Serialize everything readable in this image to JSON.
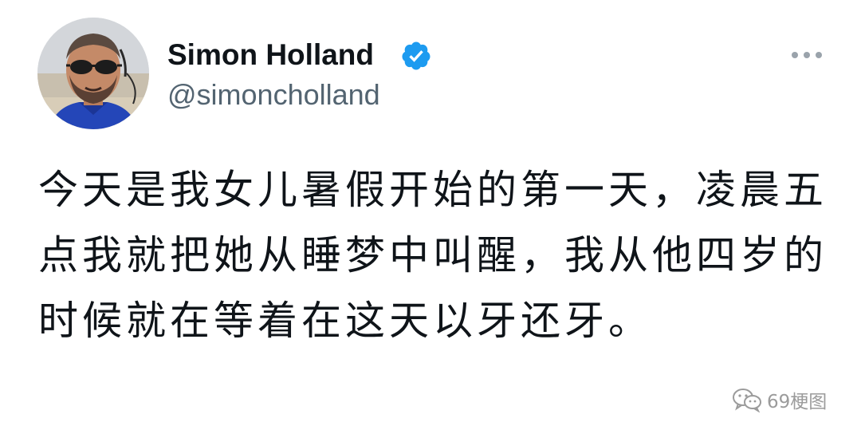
{
  "tweet": {
    "author": {
      "display_name": "Simon Holland",
      "handle": "@simoncholland",
      "verified": true,
      "verified_color": "#1d9bf0"
    },
    "more_icon": "more-horizontal-icon",
    "text": "今天是我女儿暑假开始的第一天，凌晨五点我就把她从睡梦中叫醒，我从他四岁的时候就在等着在这天以牙还牙。"
  },
  "watermark": {
    "icon": "wechat-icon",
    "label": "69梗图"
  },
  "colors": {
    "name_text": "#0f1419",
    "handle_text": "#536471",
    "background": "#ffffff"
  }
}
